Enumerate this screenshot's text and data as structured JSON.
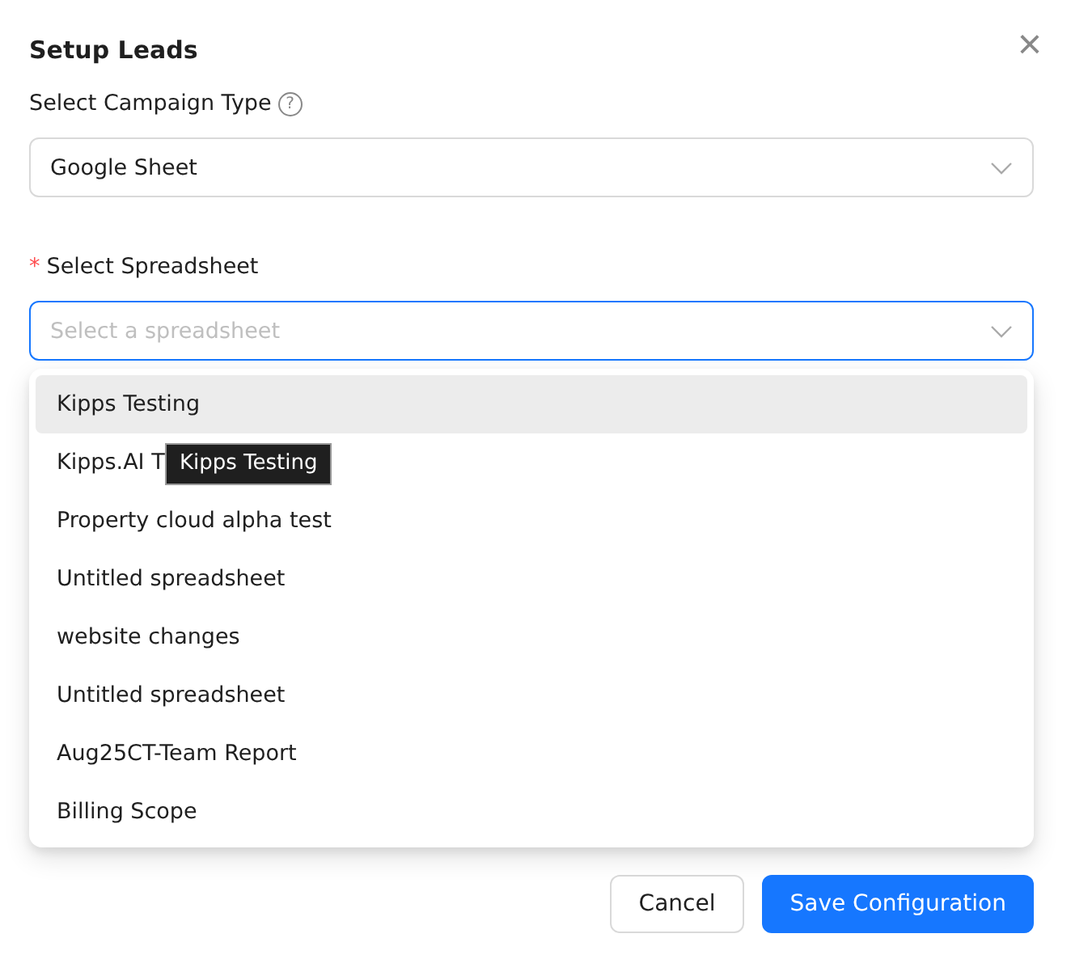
{
  "dialog": {
    "title": "Setup Leads",
    "close": "×"
  },
  "campaign_type": {
    "label": "Select Campaign Type",
    "help": "?",
    "value": "Google Sheet"
  },
  "spreadsheet": {
    "label": "Select Spreadsheet",
    "required_mark": "*",
    "placeholder": "Select a spreadsheet",
    "focused": true
  },
  "options": [
    {
      "label": "Kipps Testing",
      "highlighted": true
    },
    {
      "label": "Kipps.AI T",
      "highlighted": false,
      "tooltip": "Kipps Testing"
    },
    {
      "label": "Property cloud alpha test",
      "highlighted": false
    },
    {
      "label": "Untitled spreadsheet",
      "highlighted": false
    },
    {
      "label": "website changes",
      "highlighted": false
    },
    {
      "label": "Untitled spreadsheet",
      "highlighted": false
    },
    {
      "label": "Aug25CT-Team Report",
      "highlighted": false
    },
    {
      "label": "Billing Scope",
      "highlighted": false
    }
  ],
  "buttons": [
    {
      "label": "Cancel",
      "kind": "default"
    },
    {
      "label": "Save Configuration",
      "kind": "primary"
    }
  ]
}
